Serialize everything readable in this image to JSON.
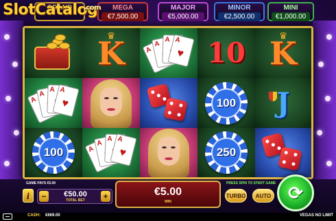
{
  "watermark": {
    "text": "SlotCatalog",
    "suffix": ".com"
  },
  "jackpots": {
    "grand": {
      "label": "GRAND",
      "value": ""
    },
    "mega": {
      "label": "MEGA",
      "value": "€7,500.00"
    },
    "major": {
      "label": "MAJOR",
      "value": "€5,000.00"
    },
    "minor": {
      "label": "MINOR",
      "value": "€2,500.00"
    },
    "mini": {
      "label": "MINI",
      "value": "€1,000.00"
    }
  },
  "reels": {
    "symbol_kinds": [
      "bag",
      "k",
      "cards",
      "ten",
      "k",
      "cards",
      "woman",
      "dice",
      "chip",
      "j",
      "chip",
      "cards",
      "woman",
      "chip",
      "dice"
    ],
    "k_letter": "K",
    "ten_letter": "10",
    "j_letter": "J",
    "card_rank": "A",
    "card_suit": "♥",
    "chip_values": {
      "r2c0": "100",
      "r1c3": "100",
      "r2c3": "250"
    }
  },
  "panel": {
    "game_pays": "GAME PAYS €5.00",
    "press_spin": "PRESS SPIN TO START GAME",
    "info_label": "i",
    "bet_minus": "−",
    "bet_plus": "+",
    "bet_value": "€50.00",
    "bet_label": "TOTAL BET",
    "win_value": "€5.00",
    "win_label": "WIN",
    "turbo_label": "TURBO",
    "auto_label": "AUTO",
    "spin_icon": "⟳"
  },
  "status": {
    "cash_label": "CASH:",
    "cash_value": "€669.00",
    "game_name": "VEGAS NO LIMIT"
  },
  "colors": {
    "frame_gold": "#e0b544",
    "spin_green": "#1fb52a",
    "win_red": "#8a1418"
  },
  "icons": {
    "info": "info-icon",
    "spin": "spin-arrows-icon",
    "menu": "menu-icon"
  }
}
